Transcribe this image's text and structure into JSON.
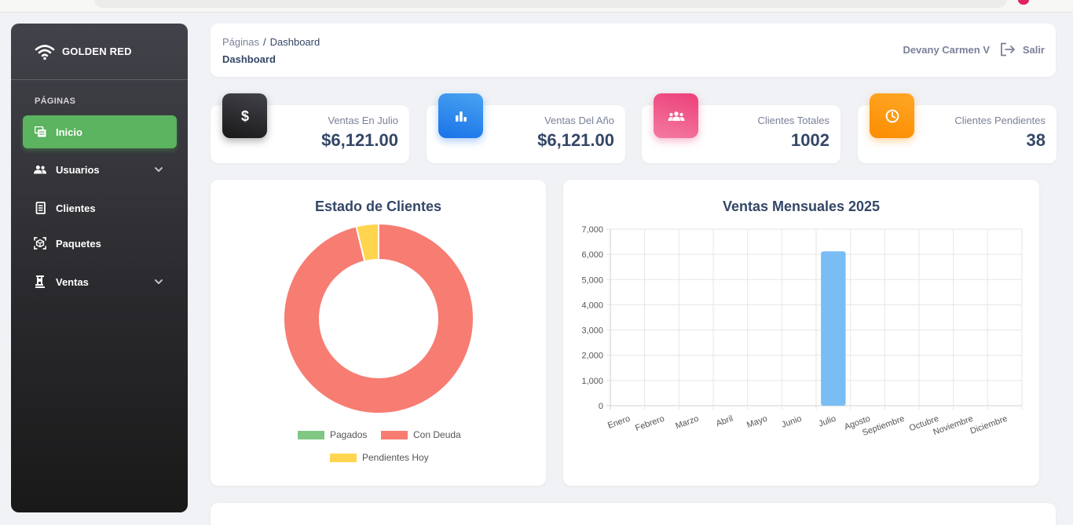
{
  "brand": {
    "name": "GOLDEN RED"
  },
  "sidebar": {
    "section": "PÁGINAS",
    "items": [
      {
        "label": "Inicio",
        "icon": "dashboard-icon",
        "active": true
      },
      {
        "label": "Usuarios",
        "icon": "users-icon",
        "expandable": true
      },
      {
        "label": "Clientes",
        "icon": "receipt-icon"
      },
      {
        "label": "Paquetes",
        "icon": "package-icon"
      },
      {
        "label": "Ventas",
        "icon": "sales-icon",
        "expandable": true
      }
    ]
  },
  "header": {
    "breadcrumb_root": "Páginas",
    "breadcrumb_sep": "/",
    "breadcrumb_current": "Dashboard",
    "title": "Dashboard",
    "user": "Devany Carmen V",
    "logout": "Salir"
  },
  "stats": [
    {
      "label": "Ventas En Julio",
      "value": "$6,121.00",
      "icon": "dollar-icon",
      "color": "#262626"
    },
    {
      "label": "Ventas Del Año",
      "value": "$6,121.00",
      "icon": "bar-chart-icon",
      "color": "#2b7fe4"
    },
    {
      "label": "Clientes Totales",
      "value": "1002",
      "icon": "group-icon",
      "color": "#ec5e8f"
    },
    {
      "label": "Clientes Pendientes",
      "value": "38",
      "icon": "clock-icon",
      "color": "#fb8c00"
    }
  ],
  "chart_data": [
    {
      "type": "pie",
      "title": "Estado de Clientes",
      "categories": [
        "Pagados",
        "Con Deuda",
        "Pendientes Hoy"
      ],
      "values": [
        0,
        964,
        38
      ],
      "colors": [
        "#81c784",
        "#f77c72",
        "#ffd54f"
      ],
      "legend": "bottom"
    },
    {
      "type": "bar",
      "title": "Ventas Mensuales 2025",
      "categories": [
        "Enero",
        "Febrero",
        "Marzo",
        "Abril",
        "Mayo",
        "Junio",
        "Julio",
        "Agosto",
        "Septiembre",
        "Octubre",
        "Noviembre",
        "Diciembre"
      ],
      "values": [
        0,
        0,
        0,
        0,
        0,
        0,
        6121,
        0,
        0,
        0,
        0,
        0
      ],
      "ylim": [
        0,
        7000
      ],
      "yticks": [
        "0",
        "1,000",
        "2,000",
        "3,000",
        "4,000",
        "5,000",
        "6,000",
        "7,000"
      ],
      "color": "#7abdf5",
      "grid": true,
      "legend": "none"
    }
  ]
}
